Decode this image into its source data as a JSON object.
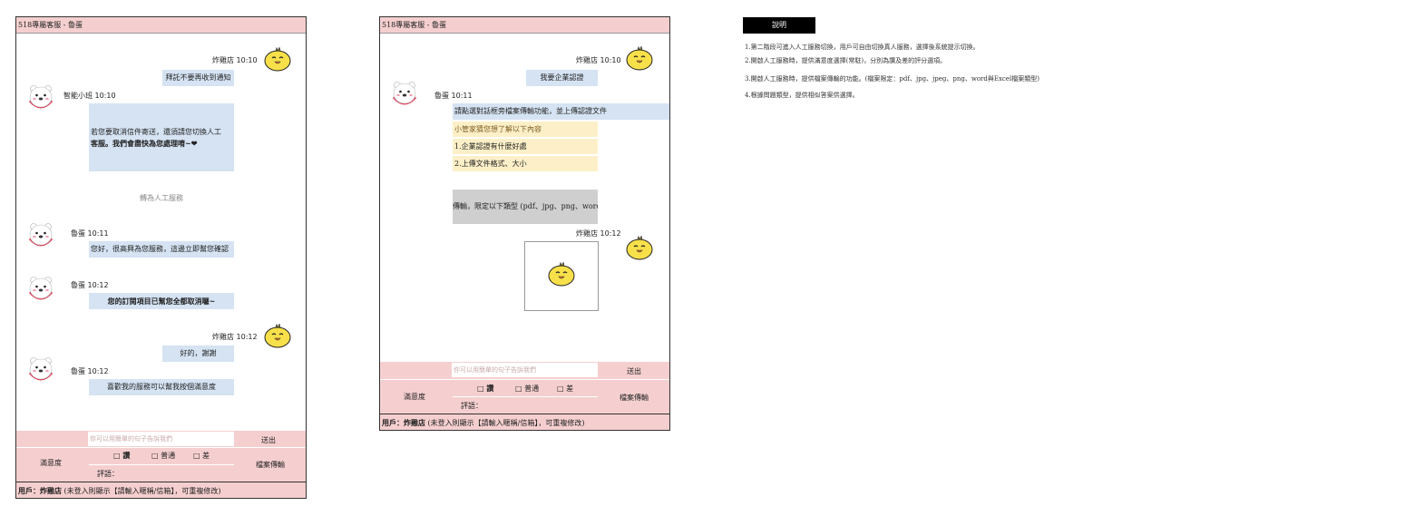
{
  "panel1": {
    "title": "518專屬客服 - 魯蛋",
    "messages": [
      {
        "sender": "炸雞店 10:10",
        "text": "拜託不要再收到通知"
      },
      {
        "sender": "智能小班 10:10",
        "text_line1": "若您要取消信件寄送，還須請您切換人工",
        "text_line2": "客服。我們會盡快為您處理唷~❤"
      },
      {
        "system": "轉為人工服務"
      },
      {
        "sender": "魯蛋 10:11",
        "text": "您好，很高興為您服務，這邊立即幫您確認"
      },
      {
        "sender": "魯蛋 10:12",
        "text": "您的訂閱項目已幫您全都取消囉~"
      },
      {
        "sender": "炸雞店 10:12",
        "text": "好的，謝謝"
      },
      {
        "sender": "魯蛋 10:12",
        "text": "喜歡我的服務可以幫我按個滿意度"
      }
    ],
    "input_placeholder": "你可以用簡單的句子告訴我們",
    "send_label": "送出",
    "satisfaction_label": "滿意度",
    "rating_options": [
      "讚",
      "普通",
      "差"
    ],
    "comment_label": "評語：",
    "file_transfer_label": "檔案傳輸",
    "user_prefix": "用戶：炸雞店",
    "user_note": "(未登入則顯示【請輸入暱稱/信箱】，可重複修改)"
  },
  "panel2": {
    "title": "518專屬客服 - 魯蛋",
    "messages": [
      {
        "sender": "炸雞店 10:10",
        "text": "我要企業認證"
      },
      {
        "sender": "魯蛋 10:11",
        "text": "請點選對話框旁檔案傳輸功能，並上傳認證文件"
      },
      {
        "faq": [
          "小管家猜您想了解以下內容",
          "1.企業認證有什麼好處",
          "2.上傳文件格式、大小"
        ]
      },
      {
        "text": "傳輸，限定以下類型 (pdf、jpg、png、word"
      },
      {
        "sender": "炸雞店 10:12",
        "attachment": "image"
      }
    ],
    "input_placeholder": "你可以用簡單的句子告訴我們",
    "send_label": "送出",
    "satisfaction_label": "滿意度",
    "rating_options": [
      "讚",
      "普通",
      "差"
    ],
    "comment_label": "評語：",
    "file_transfer_label": "檔案傳輸",
    "user_prefix": "用戶：炸雞店",
    "user_note": "(未登入則顯示【請輸入暱稱/信箱】，可重複修改)"
  },
  "notes": {
    "title": "說明",
    "lines": [
      "1.第二階段可進入人工服務切換，用戶可自由切換真人服務，選擇後系統提示切換。",
      "2.開啟人工服務時，提供滿意度選擇(常駐)，分別為讚及差的評分選項。",
      "3.開啟人工服務時，提供檔案傳輸的功能。(檔案限定：pdf、jpg、jpeg、png、word與Excel檔案類型)",
      "4.根據問題類型，提供相似答案供選擇。"
    ]
  },
  "colors": {
    "header_pink": "#f5cfcf",
    "bubble_blue": "#d5e3f3",
    "bubble_yellow": "#fdf0c8",
    "bubble_gray": "#cfcfcf",
    "chick_yellow": "#f7e04a",
    "bear_red": "#e0435a"
  },
  "icons": [
    "chick-avatar-icon",
    "bear-avatar-icon",
    "checkbox-icon"
  ]
}
